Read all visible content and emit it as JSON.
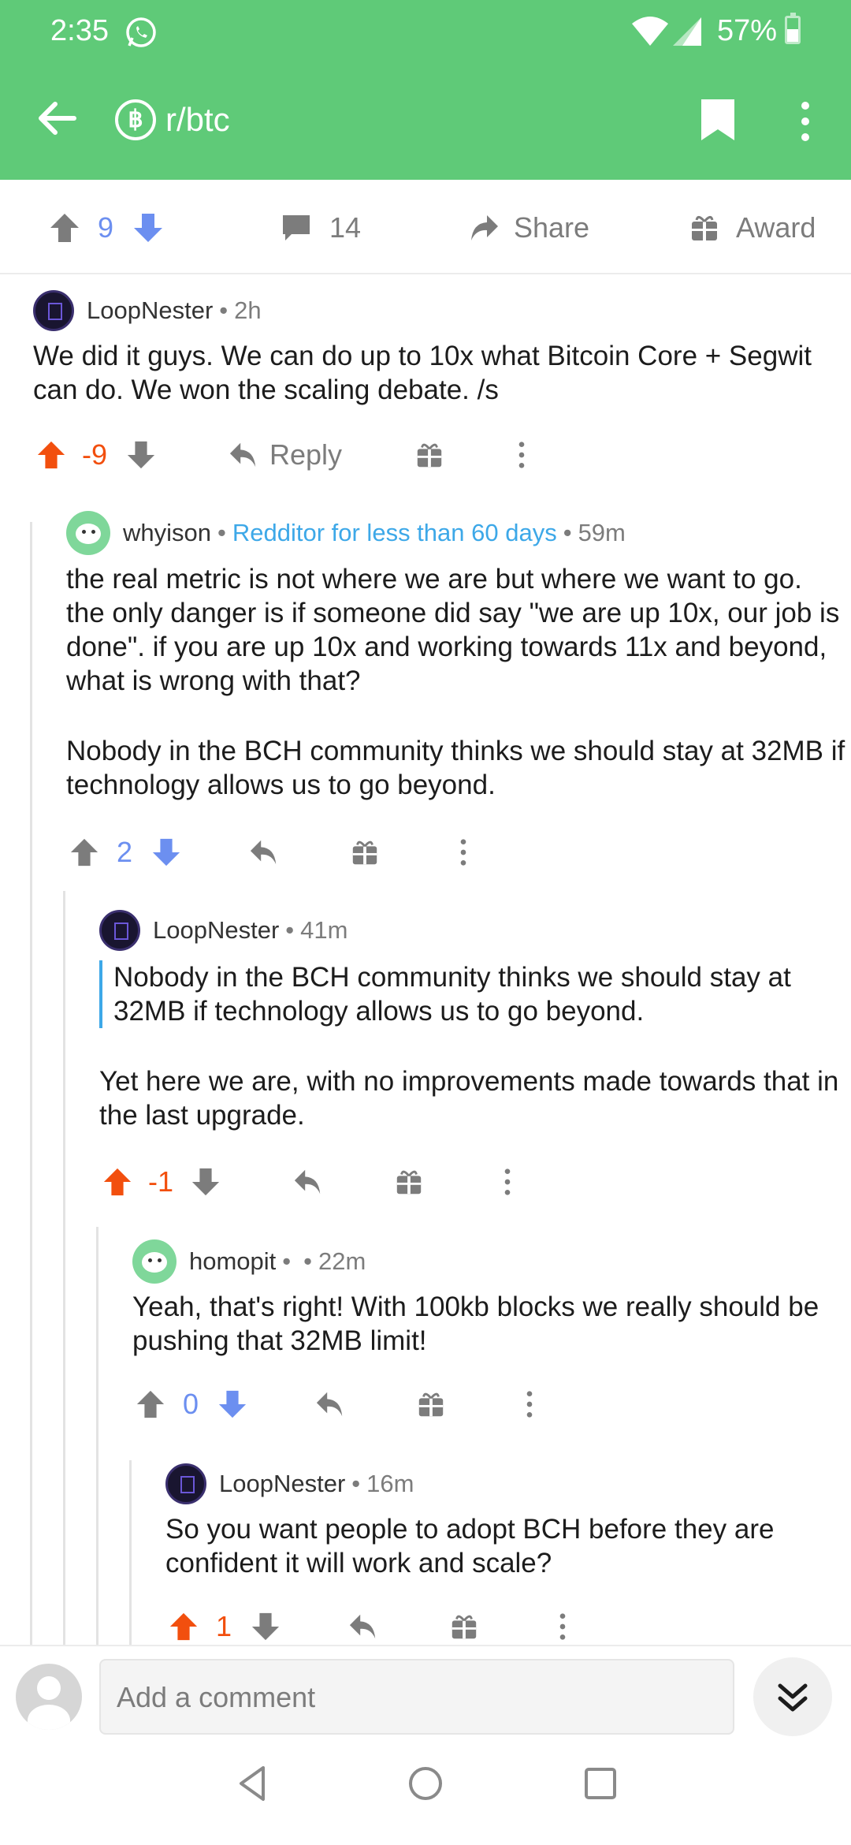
{
  "status_bar": {
    "time": "2:35",
    "battery": "57%"
  },
  "app_bar": {
    "subreddit": "r/btc",
    "sub_icon": "฿"
  },
  "post_bar": {
    "score": "9",
    "comments": "14",
    "share_label": "Share",
    "award_label": "Award"
  },
  "comments": [
    {
      "user": "LoopNester",
      "flair": "",
      "age": "2h",
      "body": [
        "We did it guys. We can do up to 10x what Bitcoin Core + Segwit can do.  We won the scaling debate. /s"
      ],
      "score": "-9",
      "reply_label": "Reply"
    },
    {
      "user": "whyison",
      "flair": "Redditor for less than 60 days",
      "age": "59m",
      "body": [
        "the real metric is not where we are but where we want to go.  the only danger is if someone did say \"we are up 10x, our job is done\".  if you are up 10x and working towards 11x and beyond, what is wrong with that?",
        "Nobody in the BCH community thinks we should stay at 32MB if technology allows us to go beyond."
      ],
      "score": "2"
    },
    {
      "user": "LoopNester",
      "flair": "",
      "age": "41m",
      "quote": "Nobody in the BCH community thinks we should stay at 32MB if technology allows us to go beyond.",
      "body": [
        "Yet here we are, with no improvements made towards that in the last upgrade."
      ],
      "score": "-1"
    },
    {
      "user": "homopit",
      "flair": "",
      "age": "22m",
      "body": [
        "Yeah, that's right! With 100kb blocks we really should be pushing that 32MB limit!"
      ],
      "score": "0"
    },
    {
      "user": "LoopNester",
      "flair": "",
      "age": "16m",
      "body": [
        "So you want people to adopt BCH before they are confident it will work and scale?"
      ],
      "score": "1"
    }
  ],
  "composer": {
    "placeholder": "Add a comment"
  },
  "colors": {
    "header": "#5fca78",
    "upvote": "#f24f0e",
    "downvote": "#6c8ff0",
    "flair": "#3da8e8"
  }
}
